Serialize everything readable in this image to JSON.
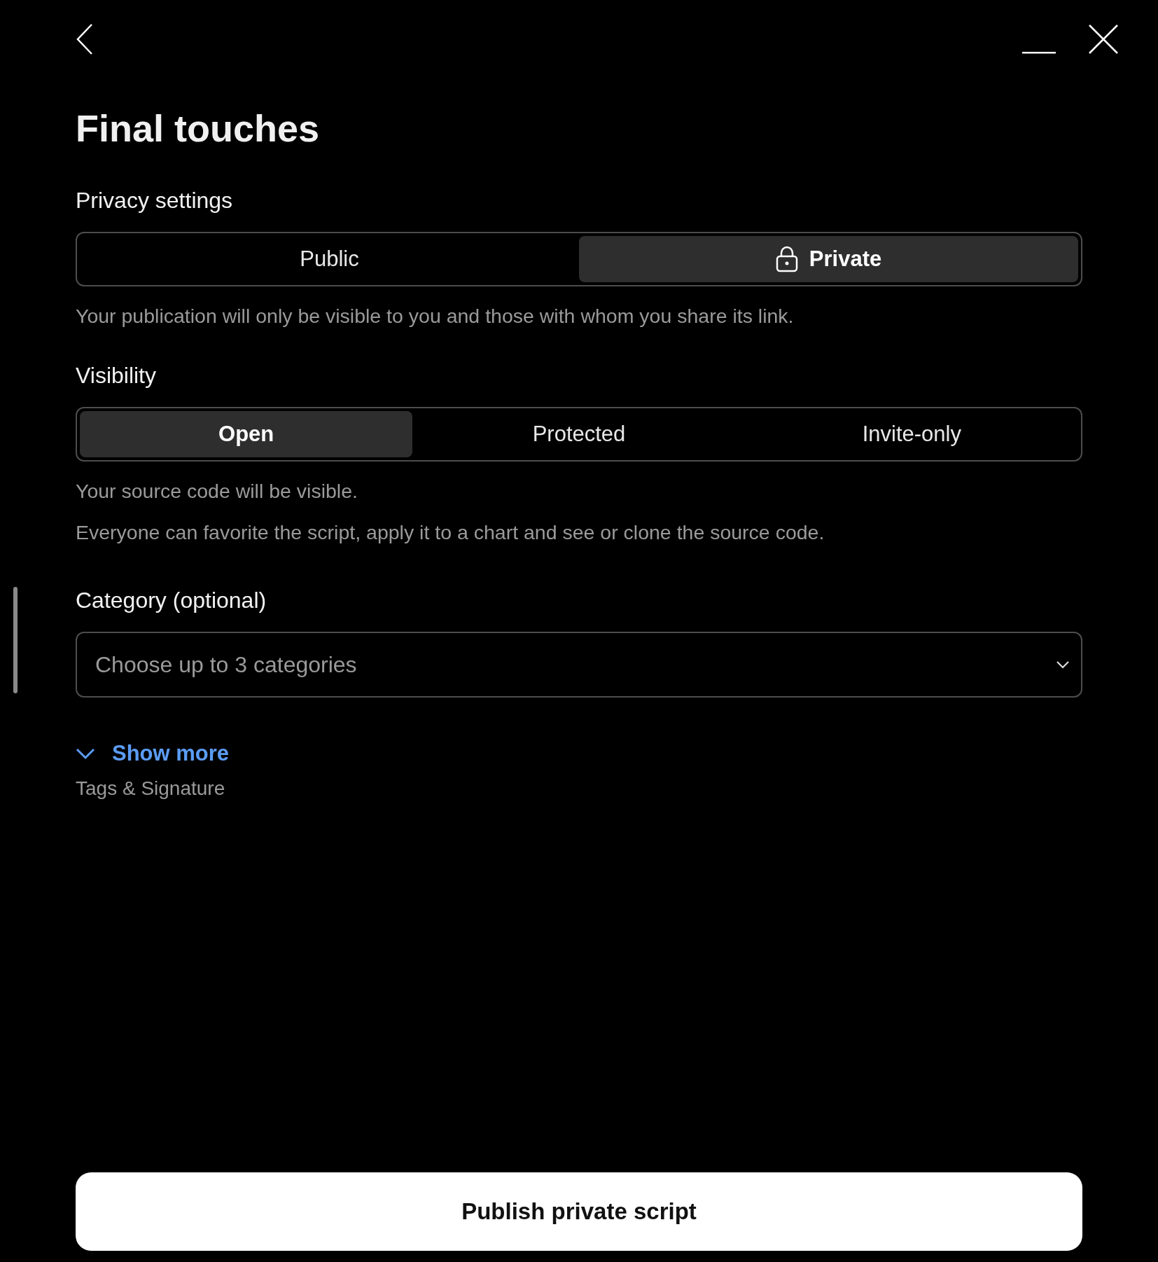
{
  "title": "Final touches",
  "privacy": {
    "label": "Privacy settings",
    "options": [
      {
        "label": "Public",
        "selected": false,
        "kind": "plain"
      },
      {
        "label": "Private",
        "selected": true,
        "kind": "locked"
      }
    ],
    "description": "Your publication will only be visible to you and those with whom you share its link."
  },
  "visibility": {
    "label": "Visibility",
    "options": [
      {
        "label": "Open",
        "selected": true
      },
      {
        "label": "Protected",
        "selected": false
      },
      {
        "label": "Invite-only",
        "selected": false
      }
    ],
    "descriptions": [
      "Your source code will be visible.",
      "Everyone can favorite the script, apply it to a chart and see or clone the source code."
    ]
  },
  "category": {
    "label": "Category (optional)",
    "placeholder": "Choose up to 3 categories"
  },
  "show_more": {
    "label": "Show more",
    "expanded": false,
    "subtitle": "Tags & Signature"
  },
  "submit": {
    "label": "Publish private script"
  }
}
